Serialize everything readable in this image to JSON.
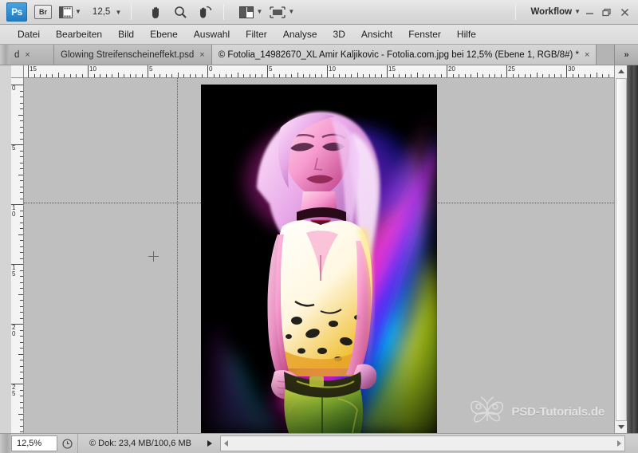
{
  "app": {
    "name": "Adobe Photoshop",
    "logo_text": "Ps",
    "bridge_label": "Br",
    "zoom_value": "12,5",
    "workflow_label": "Workflow",
    "minimize": "–",
    "restore": "❐",
    "close": "×"
  },
  "toolbar": {
    "items": [
      {
        "name": "bridge-button",
        "label": "Br"
      },
      {
        "name": "mini-bridge-button",
        "label": ""
      },
      {
        "name": "zoom-level-dropdown",
        "label": "12,5"
      },
      {
        "name": "hand-tool",
        "label": ""
      },
      {
        "name": "zoom-tool",
        "label": ""
      },
      {
        "name": "rotate-view-tool",
        "label": ""
      },
      {
        "name": "arrange-documents-button",
        "label": ""
      },
      {
        "name": "screen-mode-button",
        "label": ""
      }
    ],
    "caret": "▼"
  },
  "menubar": {
    "items": [
      "Datei",
      "Bearbeiten",
      "Bild",
      "Ebene",
      "Auswahl",
      "Filter",
      "Analyse",
      "3D",
      "Ansicht",
      "Fenster",
      "Hilfe"
    ]
  },
  "tabs": {
    "close_glyph": "×",
    "overflow_label": "»",
    "items": [
      {
        "title": "d",
        "active": false,
        "clipped": true
      },
      {
        "title": "Glowing Streifenscheineffekt.psd",
        "active": false,
        "clipped": false
      },
      {
        "title": "© Fotolia_14982670_XL Amir Kaljikovic - Fotolia.com.jpg bei 12,5% (Ebene 1, RGB/8#) *",
        "active": true,
        "clipped": false
      }
    ]
  },
  "rulers": {
    "unit": "cm",
    "horizontal_labels": [
      "15",
      "10",
      "5",
      "0",
      "5",
      "10",
      "15",
      "20",
      "25",
      "30"
    ],
    "vertical_labels": [
      "0",
      "5",
      "10",
      "15",
      "20",
      "25"
    ]
  },
  "canvas": {
    "document_title": "Fotolia_14982670_XL Amir Kaljikovic - Fotolia.com.jpg",
    "background_color": "#bfbfbf",
    "cursor": "crosshair",
    "watermark_text": "PSD-Tutorials.de"
  },
  "statusbar": {
    "zoom_percent": "12,5%",
    "doc_info": "© Dok: 23,4 MB/100,6 MB",
    "play_glyph": "▶"
  }
}
